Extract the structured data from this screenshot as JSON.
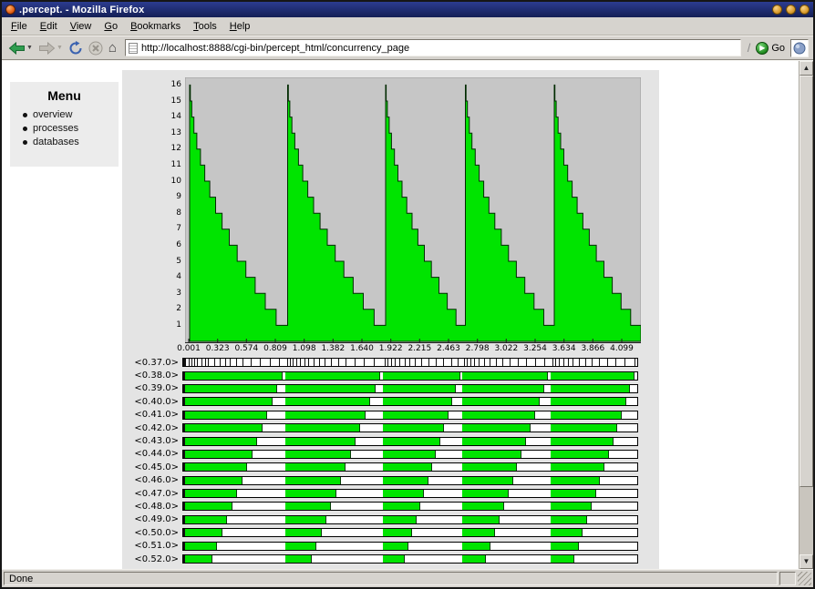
{
  "window": {
    "title": ".percept. - Mozilla Firefox",
    "status": "Done"
  },
  "menubar": {
    "items": [
      "File",
      "Edit",
      "View",
      "Go",
      "Bookmarks",
      "Tools",
      "Help"
    ]
  },
  "toolbar": {
    "url": "http://localhost:8888/cgi-bin/percept_html/concurrency_page",
    "go_label": "Go"
  },
  "sidebar": {
    "title": "Menu",
    "items": [
      "overview",
      "processes",
      "databases"
    ]
  },
  "chart_data": {
    "type": "area",
    "title": "",
    "xlabel": "",
    "ylabel": "",
    "x_ticks": [
      "0.001",
      "0.323",
      "0.574",
      "0.809",
      "1.098",
      "1.382",
      "1.640",
      "1.922",
      "2.215",
      "2.463",
      "2.798",
      "3.022",
      "3.254",
      "3.634",
      "3.866",
      "4.099"
    ],
    "y_ticks": [
      1,
      2,
      3,
      4,
      5,
      6,
      7,
      8,
      9,
      10,
      11,
      12,
      13,
      14,
      15,
      16
    ],
    "ylim": [
      0,
      16
    ],
    "peak_count": 16,
    "min_count": 1,
    "cycle_bounds": [
      0.01,
      0.225,
      0.44,
      0.615,
      0.81,
      1.0
    ],
    "legend": "none",
    "grid": false,
    "colors": {
      "fill": "#00e400",
      "outline": "#002b00",
      "plot_bg": "#c6c6c6",
      "panel_bg": "#e4e4e4"
    }
  },
  "processes": {
    "cycle_bounds": [
      0.004,
      0.225,
      0.44,
      0.615,
      0.81,
      1.0
    ],
    "rows": [
      {
        "label": "<0.37.0>",
        "kind": "ticks",
        "ticks": [
          0.012,
          0.018,
          0.025,
          0.031,
          0.04,
          0.048,
          0.055,
          0.068,
          0.08,
          0.092,
          0.103,
          0.116,
          0.13,
          0.148,
          0.168,
          0.19,
          0.21,
          0.228,
          0.234,
          0.241,
          0.249,
          0.258,
          0.268,
          0.276,
          0.287,
          0.299,
          0.312,
          0.326,
          0.341,
          0.358,
          0.377,
          0.398,
          0.419,
          0.443,
          0.45,
          0.458,
          0.466,
          0.476,
          0.487,
          0.498,
          0.511,
          0.525,
          0.54,
          0.556,
          0.573,
          0.591,
          0.605,
          0.618,
          0.625,
          0.633,
          0.641,
          0.651,
          0.662,
          0.674,
          0.688,
          0.703,
          0.719,
          0.737,
          0.756,
          0.776,
          0.796,
          0.813,
          0.82,
          0.828,
          0.837,
          0.847,
          0.858,
          0.871,
          0.885,
          0.9,
          0.916,
          0.933,
          0.952,
          0.972,
          0.993
        ]
      },
      {
        "label": "<0.38.0>",
        "kind": "bar",
        "active_fraction": 0.97
      },
      {
        "label": "<0.39.0>",
        "kind": "bar",
        "active_fraction": 0.92
      },
      {
        "label": "<0.40.0>",
        "kind": "bar",
        "active_fraction": 0.87
      },
      {
        "label": "<0.41.0>",
        "kind": "bar",
        "active_fraction": 0.82
      },
      {
        "label": "<0.42.0>",
        "kind": "bar",
        "active_fraction": 0.77
      },
      {
        "label": "<0.43.0>",
        "kind": "bar",
        "active_fraction": 0.72
      },
      {
        "label": "<0.44.0>",
        "kind": "bar",
        "active_fraction": 0.67
      },
      {
        "label": "<0.45.0>",
        "kind": "bar",
        "active_fraction": 0.62
      },
      {
        "label": "<0.46.0>",
        "kind": "bar",
        "active_fraction": 0.57
      },
      {
        "label": "<0.47.0>",
        "kind": "bar",
        "active_fraction": 0.52
      },
      {
        "label": "<0.48.0>",
        "kind": "bar",
        "active_fraction": 0.47
      },
      {
        "label": "<0.49.0>",
        "kind": "bar",
        "active_fraction": 0.42
      },
      {
        "label": "<0.50.0>",
        "kind": "bar",
        "active_fraction": 0.37
      },
      {
        "label": "<0.51.0>",
        "kind": "bar",
        "active_fraction": 0.32
      },
      {
        "label": "<0.52.0>",
        "kind": "bar",
        "active_fraction": 0.27
      }
    ]
  }
}
